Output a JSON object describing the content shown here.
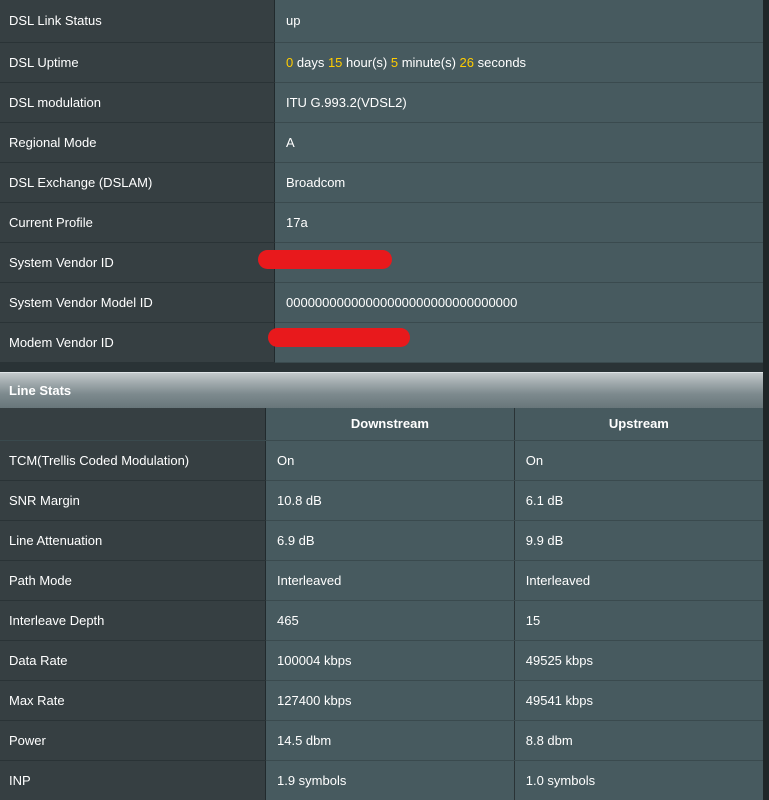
{
  "status": {
    "link_status": {
      "label": "DSL Link Status",
      "value": "up"
    },
    "uptime": {
      "label": "DSL Uptime",
      "days": "0",
      "days_unit": "days",
      "hours": "15",
      "hours_unit": "hour(s)",
      "minutes": "5",
      "minutes_unit": "minute(s)",
      "seconds": "26",
      "seconds_unit": "seconds"
    },
    "modulation": {
      "label": "DSL modulation",
      "value": "ITU G.993.2(VDSL2)"
    },
    "regional_mode": {
      "label": "Regional Mode",
      "value": "A"
    },
    "exchange": {
      "label": "DSL Exchange (DSLAM)",
      "value": "Broadcom"
    },
    "profile": {
      "label": "Current Profile",
      "value": "17a"
    },
    "system_vendor_id": {
      "label": "System Vendor ID",
      "value": ""
    },
    "system_vendor_model_id": {
      "label": "System Vendor Model ID",
      "value": "00000000000000000000000000000000"
    },
    "modem_vendor_id": {
      "label": "Modem Vendor ID",
      "value": ""
    }
  },
  "line_stats": {
    "title": "Line Stats",
    "columns": [
      "Downstream",
      "Upstream"
    ],
    "rows": [
      {
        "label": "TCM(Trellis Coded Modulation)",
        "down": "On",
        "up": "On"
      },
      {
        "label": "SNR Margin",
        "down": "10.8 dB",
        "up": "6.1 dB"
      },
      {
        "label": "Line Attenuation",
        "down": "6.9 dB",
        "up": "9.9 dB"
      },
      {
        "label": "Path Mode",
        "down": "Interleaved",
        "up": "Interleaved"
      },
      {
        "label": "Interleave Depth",
        "down": "465",
        "up": "15"
      },
      {
        "label": "Data Rate",
        "down": "100004 kbps",
        "up": "49525 kbps"
      },
      {
        "label": "Max Rate",
        "down": "127400 kbps",
        "up": "49541 kbps"
      },
      {
        "label": "Power",
        "down": "14.5 dbm",
        "up": "8.8 dbm"
      },
      {
        "label": "INP",
        "down": "1.9 symbols",
        "up": "1.0 symbols"
      }
    ]
  },
  "colors": {
    "highlight_number": "#ffcc00",
    "redaction": "#e8191c",
    "label_bg": "#363f42",
    "value_bg": "#475a5f"
  }
}
